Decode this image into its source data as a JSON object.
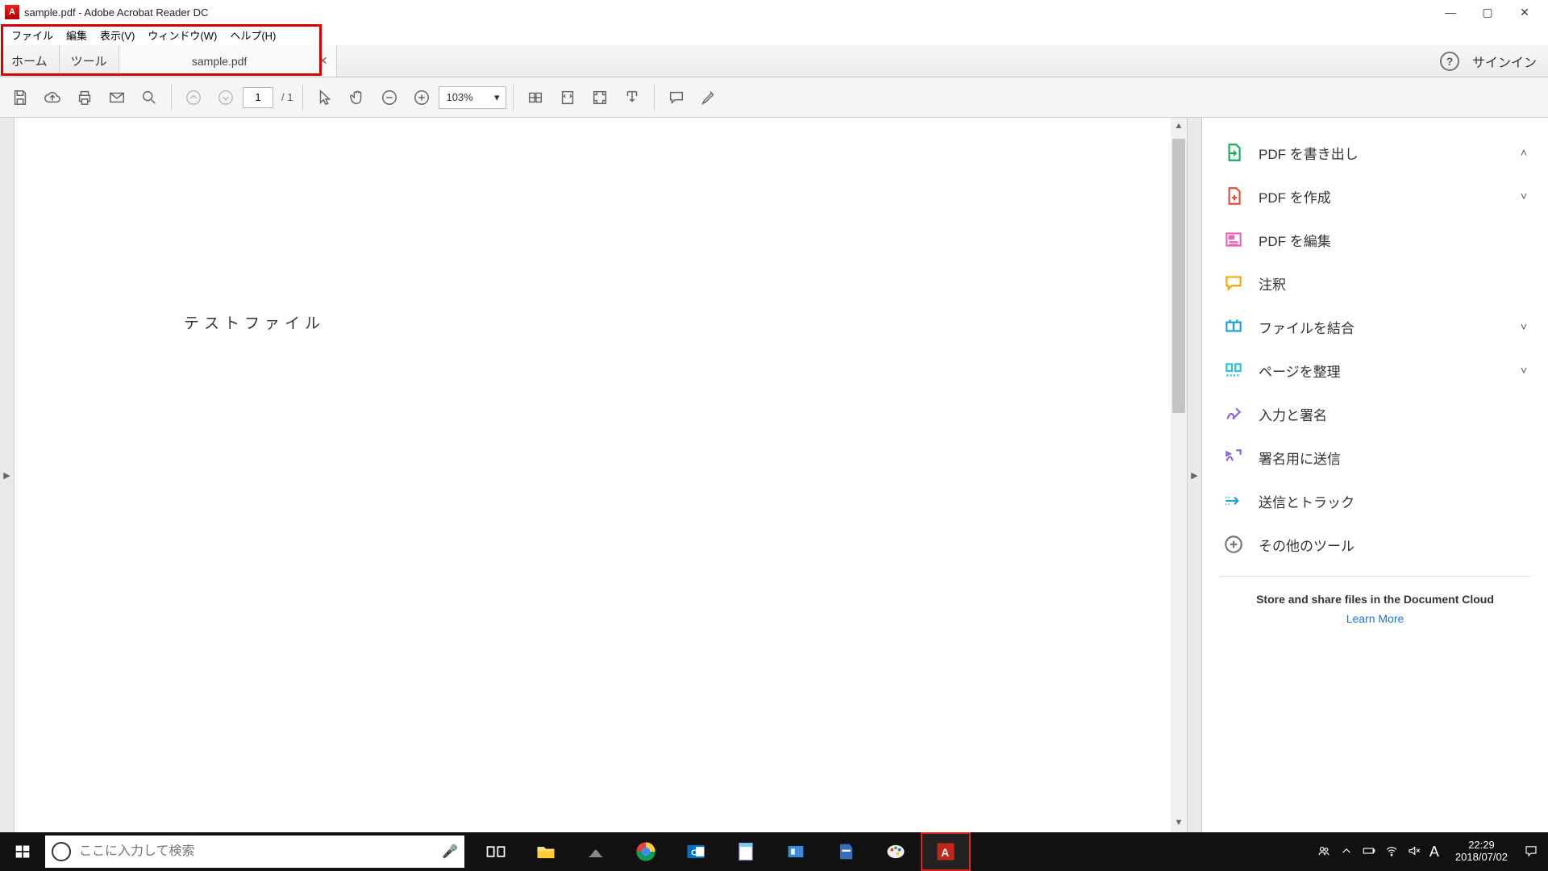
{
  "title": "sample.pdf - Adobe Acrobat Reader DC",
  "menu": {
    "file": "ファイル",
    "edit": "編集",
    "view": "表示(V)",
    "window": "ウィンドウ(W)",
    "help": "ヘルプ(H)"
  },
  "tabs": {
    "home": "ホーム",
    "tools": "ツール",
    "doc": "sample.pdf",
    "signin": "サインイン"
  },
  "toolbar": {
    "page_current": "1",
    "page_total": "/  1",
    "zoom": "103%"
  },
  "document": {
    "body_text": "テストファイル"
  },
  "tools_panel": {
    "export": "PDF を書き出し",
    "create": "PDF を作成",
    "edit": "PDF を編集",
    "comment": "注釈",
    "combine": "ファイルを結合",
    "organize": "ページを整理",
    "fillsign": "入力と署名",
    "sendforsig": "署名用に送信",
    "sendtrack": "送信とトラック",
    "more": "その他のツール"
  },
  "promo": {
    "headline": "Store and share files in the Document Cloud",
    "link": "Learn More"
  },
  "taskbar": {
    "search_placeholder": "ここに入力して検索",
    "time": "22:29",
    "date": "2018/07/02",
    "ime": "A"
  }
}
